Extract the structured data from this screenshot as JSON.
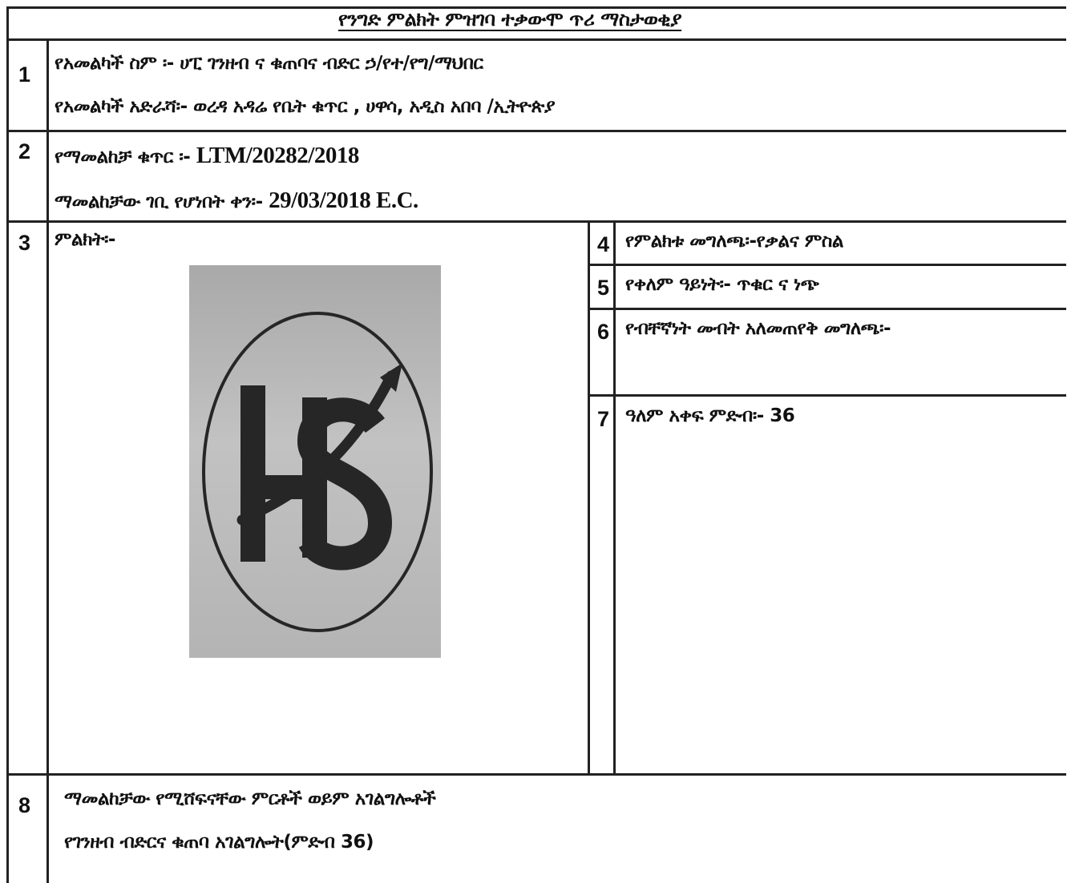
{
  "title": "የንግድ ምልክት ምዝገባ ተቃውሞ ጥሪ ማስታወቂያ",
  "rows": {
    "r1": {
      "number": "1",
      "owner_name": "የአመልካች ስም ፡- ሀፒ ገንዘብ ና ቁጠባና ብድር ኃ/የተ/የግ/ማህበር",
      "owner_address": "የአመልካች አድራሻ፡- ወረዳ  አዳሬ የቤት ቁጥር  , ሀዋሳ, አዲስ አበባ /ኢትዮጵያ"
    },
    "r2": {
      "number": "2",
      "app_label": "የማመልከቻ ቁጥር ፡- ",
      "app_value": "LTM/20282/2018",
      "date_label": "ማመልከቻው ገቢ የሆነበት ቀን፡- ",
      "date_value": "29/03/2018 E.C."
    },
    "r3": {
      "number": "3",
      "label": "ምልክት፡-"
    },
    "r4": {
      "number": "4",
      "text": "የምልክቱ መግለጫ፡-የቃልና ምስል"
    },
    "r5": {
      "number": "5",
      "text": "የቀለም ዓይነት፡- ጥቁር ና ነጭ"
    },
    "r6": {
      "number": "6",
      "text": "የብቸኛነት መብት አለመጠየቅ መግለጫ፡-"
    },
    "r7": {
      "number": "7",
      "text": "ዓለም አቀፍ ምድብ፡- 36"
    },
    "r8": {
      "number": "8",
      "heading": "ማመልከቻው የሚሸፍናቸው ምርቶች ወይም አገልግሎቶች",
      "services": "የገንዘብ  ብድርና ቁጠባ አገልግሎት(ምድብ 36)"
    }
  },
  "logo": {
    "letters": "HS",
    "color": "#262626",
    "background": "#b8b8b8"
  }
}
